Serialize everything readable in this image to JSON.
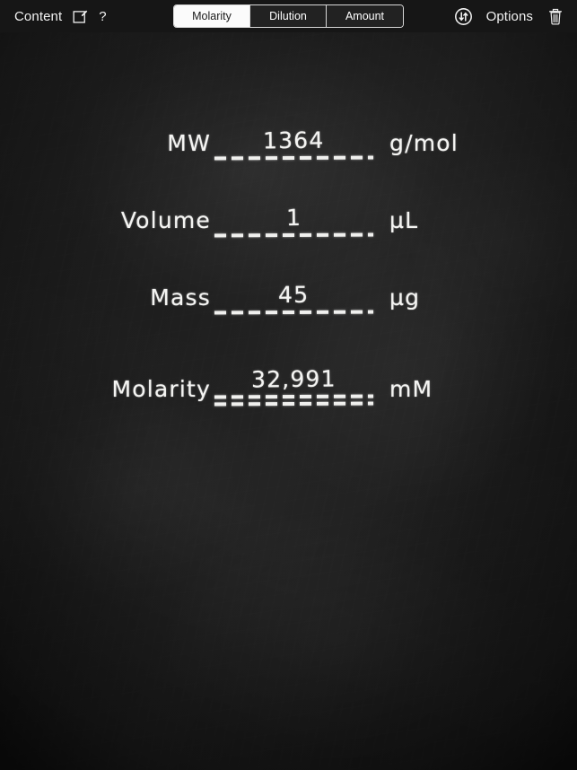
{
  "toolbar": {
    "content_label": "Content",
    "compose_icon": "compose-edit-icon",
    "help_label": "?",
    "swap_icon": "swap-vertical-circle-icon",
    "options_label": "Options",
    "trash_icon": "trash-icon",
    "segments": [
      {
        "label": "Molarity",
        "selected": true
      },
      {
        "label": "Dilution",
        "selected": false
      },
      {
        "label": "Amount",
        "selected": false
      }
    ]
  },
  "calculator": {
    "mode": "Molarity",
    "rows": [
      {
        "label": "MW",
        "value": "1364",
        "unit": "g/mol",
        "underlines": 1,
        "computed": false
      },
      {
        "label": "Volume",
        "value": "1",
        "unit": "µL",
        "underlines": 1,
        "computed": false
      },
      {
        "label": "Mass",
        "value": "45",
        "unit": "µg",
        "underlines": 1,
        "computed": false
      },
      {
        "label": "Molarity",
        "value": "32,991",
        "unit": "mM",
        "underlines": 2,
        "computed": true
      }
    ]
  },
  "colors": {
    "toolbar_bg": "#161616",
    "board_bg": "#1d1d1d",
    "chalk": "#f4f4f2",
    "segment_active_bg": "#fbfbfb",
    "segment_active_text": "#1a1a1a"
  }
}
